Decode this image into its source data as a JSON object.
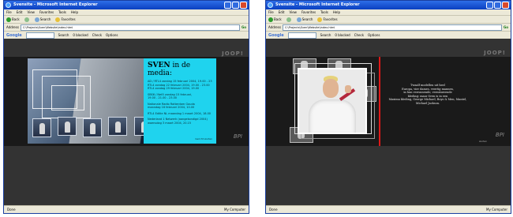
{
  "left": {
    "title": "Svensite - Microsoft Internet Explorer",
    "menu": [
      "File",
      "Edit",
      "View",
      "Favorites",
      "Tools",
      "Help"
    ],
    "toolbar": {
      "back": "Back",
      "search": "Search",
      "favorites": "Favorites"
    },
    "address": {
      "label": "Address",
      "value": "C:\\Projects\\Sven\\Website\\index.html",
      "go": "Go"
    },
    "google": {
      "logo": "Google",
      "search": "Search",
      "blocked": "0 blocked",
      "check": "Check",
      "options": "Options"
    },
    "brand": "JOOP!",
    "panel": {
      "title_name": "SVEN",
      "title_rest": "in de media:",
      "lines": [
        "AD / RTL4 zondag 15 februari 2004, 19.00 - 23.00",
        "RTL4 zondag 22 februari 2004, 19.00 - 23.00",
        "RTL4 zondag 29 februari 2004, 19.00",
        "",
        "SBS6 / Net5 zondag 15 februari,",
        "19.00 - 21.00 - 23.00",
        "",
        "Nationale Radio Rotterdam Gouda",
        "maandag 16 februari 2004, 10.00",
        "",
        "RTL4 Editie NL maandag 1 maart 2004, 18.00",
        "",
        "Nederland 1 Netwerk (aangekondigd 2004)",
        "woensdag 3 maart 2004, 20.15"
      ],
      "footer": "bericht sluiten"
    },
    "watermark": "BPI",
    "status": {
      "left": "Done",
      "right": "My Computer"
    }
  },
  "right": {
    "title": "Svensite - Microsoft Internet Explorer",
    "menu": [
      "File",
      "Edit",
      "View",
      "Favorites",
      "Tools",
      "Help"
    ],
    "toolbar": {
      "back": "Back",
      "search": "Search",
      "favorites": "Favorites"
    },
    "address": {
      "label": "Address",
      "value": "C:\\Projects\\Sven\\Website\\index.html",
      "go": "Go"
    },
    "google": {
      "logo": "Google",
      "search": "Search",
      "blocked": "0 blocked",
      "check": "Check",
      "options": "Options"
    },
    "brand": "JOOP!",
    "quote": [
      "Twaalf modellen uit heel",
      "Europa, vier dames, veertig mannen,",
      "in hun verrassende, vernieuwende",
      "kleding: maar Sven is in een",
      "Maxima kleding, George Michael, Boys & Men, Mantel,",
      "Michael Jackson."
    ],
    "footer": "sluiten",
    "watermark": "BPI",
    "status": {
      "left": "Done",
      "right": "My Computer"
    }
  },
  "colors": {
    "accent_cyan": "#1fd3ee",
    "accent_red": "#e01818",
    "page_bg": "#333333"
  }
}
